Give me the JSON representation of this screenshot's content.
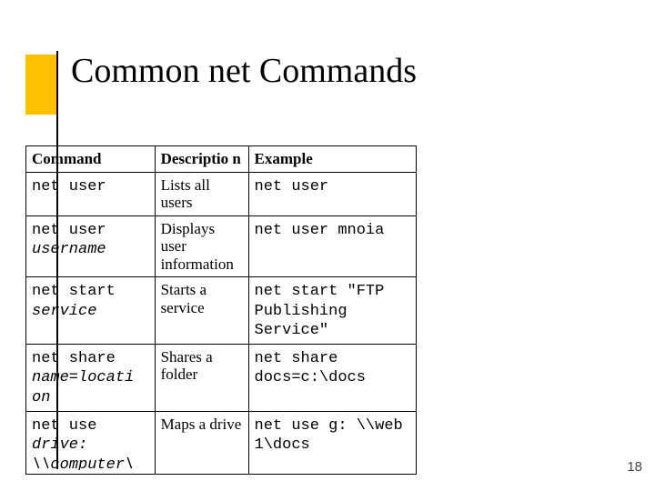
{
  "title": "Common net Commands",
  "page_number": "18",
  "headers": {
    "command": "Command",
    "description": "Descriptio\nn",
    "example": "Example"
  },
  "rows": [
    {
      "cmd_mono": "net user",
      "cmd_ital": "",
      "desc": "Lists all users",
      "ex": "net user"
    },
    {
      "cmd_mono": "net user ",
      "cmd_ital": "username",
      "desc": "Displays user information",
      "ex": "net user mnoia"
    },
    {
      "cmd_mono": "net start ",
      "cmd_ital": "service",
      "desc": "Starts a service",
      "ex": "net start \"FTP Publishing Service\""
    },
    {
      "cmd_mono": "net share ",
      "cmd_ital": "name=locati\non",
      "desc": "Shares a folder",
      "ex": "net share docs=c:\\docs"
    },
    {
      "cmd_mono": "net use ",
      "cmd_ital": "drive: \\\\computer\\",
      "desc": "Maps a drive",
      "ex": "net use g: \\\\web 1\\docs"
    }
  ]
}
